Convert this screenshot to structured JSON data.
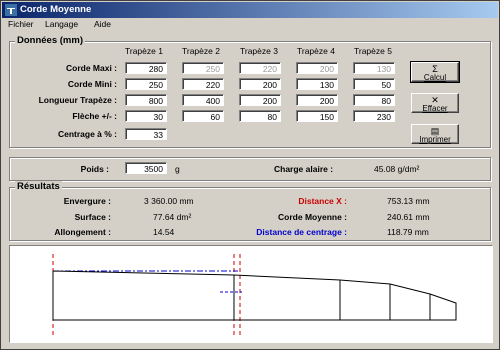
{
  "window": {
    "title": "Corde Moyenne"
  },
  "menu": {
    "items": [
      "Fichier",
      "Langage",
      "Aide"
    ]
  },
  "donnees": {
    "group_title": "Données (mm)",
    "columns": [
      "Trapèze 1",
      "Trapèze 2",
      "Trapèze 3",
      "Trapèze 4",
      "Trapèze 5"
    ],
    "rows": [
      {
        "label": "Corde Maxi :",
        "values": [
          "280",
          "250",
          "220",
          "200",
          "130"
        ],
        "enabled": [
          true,
          false,
          false,
          false,
          false
        ]
      },
      {
        "label": "Corde Mini :",
        "values": [
          "250",
          "220",
          "200",
          "130",
          "50"
        ],
        "enabled": [
          true,
          true,
          true,
          true,
          true
        ]
      },
      {
        "label": "Longueur Trapèze :",
        "values": [
          "800",
          "400",
          "200",
          "200",
          "80"
        ],
        "enabled": [
          true,
          true,
          true,
          true,
          true
        ]
      },
      {
        "label": "Flèche +/- :",
        "values": [
          "30",
          "60",
          "80",
          "150",
          "230"
        ],
        "enabled": [
          true,
          true,
          true,
          true,
          true
        ]
      }
    ],
    "centrage_label": "Centrage à % :",
    "centrage_value": "33"
  },
  "buttons": {
    "calcul": {
      "label": "Calcul",
      "icon": "sigma-icon",
      "glyph": "Σ"
    },
    "effacer": {
      "label": "Effacer",
      "icon": "clear-x-icon",
      "glyph": "✕"
    },
    "imprimer": {
      "label": "Imprimer",
      "icon": "printer-icon",
      "glyph": "▤"
    }
  },
  "poids": {
    "label": "Poids :",
    "value": "3500",
    "unit": "g"
  },
  "charge": {
    "label": "Charge alaire :",
    "value": "45.08 g/dm²"
  },
  "resultats": {
    "group_title": "Résultats",
    "envergure": {
      "label": "Envergure :",
      "value": "3 360.00 mm"
    },
    "surface": {
      "label": "Surface :",
      "value": "77.64 dm²"
    },
    "allongement": {
      "label": "Allongement :",
      "value": "14.54"
    },
    "distance_x": {
      "label": "Distance X :",
      "value": "753.13 mm",
      "color": "#cc0000"
    },
    "corde_moyenne": {
      "label": "Corde Moyenne :",
      "value": "240.61 mm"
    },
    "distance_centrage": {
      "label": "Distance de centrage :",
      "value": "118.79 mm",
      "color": "#0000cc"
    }
  }
}
